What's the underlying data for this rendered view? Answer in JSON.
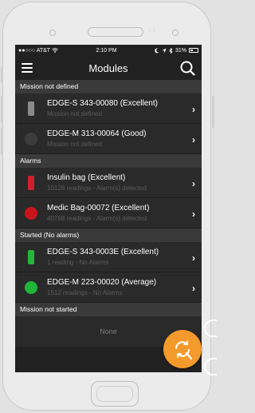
{
  "status_bar": {
    "carrier": "●●○○○ AT&T",
    "time": "2:10 PM",
    "battery": "31%"
  },
  "nav": {
    "title": "Modules"
  },
  "sections": [
    {
      "header": "Mission not defined",
      "rows": [
        {
          "title": "EDGE-S  343-00080 (Excellent)",
          "subtitle": "Mission not defined",
          "indicator": "rect",
          "color": "#8a8a8a"
        },
        {
          "title": "EDGE-M  313-00064 (Good)",
          "subtitle": "Mission not defined",
          "indicator": "circle",
          "color": "#3c3c3c"
        }
      ]
    },
    {
      "header": "Alarms",
      "rows": [
        {
          "title": "Insulin bag (Excellent)",
          "subtitle": "10128 readings - Alarm(s) detected",
          "indicator": "rect",
          "color": "#d0202a"
        },
        {
          "title": "Medic Bag-00072 (Excellent)",
          "subtitle": "40768 readings - Alarm(s) detected",
          "indicator": "circle",
          "color": "#c9141c"
        }
      ]
    },
    {
      "header": "Started (No alarms)",
      "rows": [
        {
          "title": "EDGE-S  343-0003E (Excellent)",
          "subtitle": "1 reading - No Alarms",
          "indicator": "rect",
          "color": "#25b53a"
        },
        {
          "title": "EDGE-M  223-00020 (Average)",
          "subtitle": "1512 readings - No Alarms",
          "indicator": "circle",
          "color": "#1fb53a"
        }
      ]
    },
    {
      "header": "Mission not started",
      "empty": "None"
    }
  ],
  "colors": {
    "accent": "#f49a2c",
    "screen_bg": "#212121",
    "row_bg": "#2a2a2a",
    "section_bg": "#3a3a3a"
  }
}
